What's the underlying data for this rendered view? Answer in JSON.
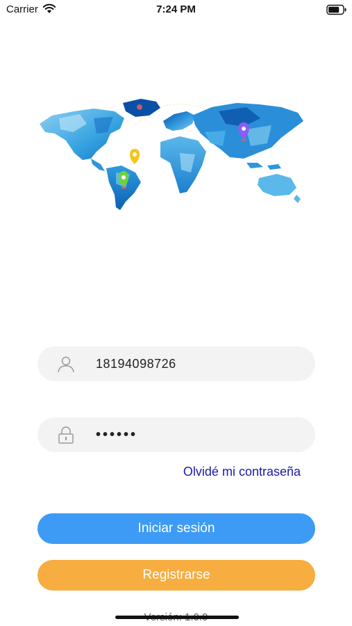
{
  "status_bar": {
    "carrier": "Carrier",
    "time": "7:24 PM"
  },
  "map": {
    "colors": {
      "light": "#7cc6ef",
      "mid": "#3aa8e4",
      "dark": "#0a4fa6",
      "pin_purple": "#8b5cf6",
      "pin_yellow": "#f5c518",
      "pin_green": "#6ed23d"
    }
  },
  "login": {
    "username_value": "18194098726",
    "password_value": "••••••",
    "username_icon": "user-icon",
    "password_icon": "lock-icon",
    "forgot_label": "Olvidé mi contraseña",
    "login_label": "Iniciar sesión",
    "register_label": "Registrarse"
  },
  "footer": {
    "version": "Versión: 1.0.0"
  },
  "colors": {
    "login_button": "#3d9bf5",
    "register_button": "#f7ad40",
    "link": "#1a1aa8"
  }
}
